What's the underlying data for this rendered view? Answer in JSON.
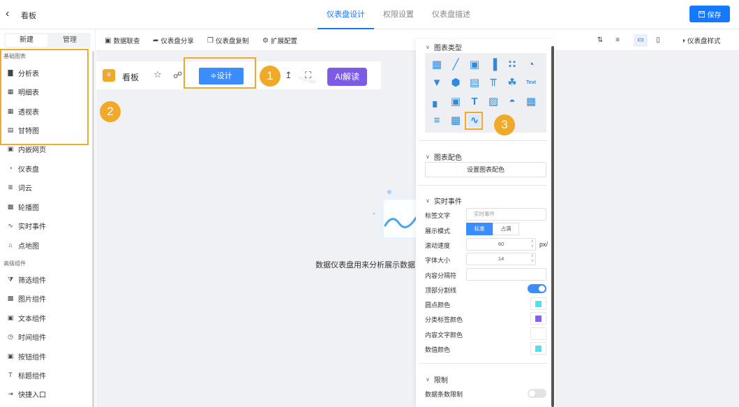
{
  "header": {
    "back_icon": "chevron-left-icon",
    "title": "看板",
    "tabs": [
      {
        "label": "仪表盘设计",
        "active": true
      },
      {
        "label": "权限设置",
        "active": false
      },
      {
        "label": "仪表盘描述",
        "active": false
      }
    ],
    "save_label": "保存",
    "accent": "#1677ff"
  },
  "sidebar": {
    "tabs": [
      "新建",
      "管理"
    ],
    "active_tab": "新建",
    "groups": [
      {
        "title": "基础图表",
        "items": [
          {
            "label": "分析表",
            "icon": "bar-chart-icon"
          },
          {
            "label": "明细表",
            "icon": "detail-table-icon"
          },
          {
            "label": "透视表",
            "icon": "pivot-table-icon"
          },
          {
            "label": "甘特图",
            "icon": "gantt-icon"
          },
          {
            "label": "内嵌网页",
            "icon": "embed-web-icon"
          },
          {
            "label": "仪表盘",
            "icon": "gauge-icon"
          },
          {
            "label": "词云",
            "icon": "word-cloud-icon"
          },
          {
            "label": "轮播图",
            "icon": "carousel-icon"
          },
          {
            "label": "实时事件",
            "icon": "realtime-event-icon"
          },
          {
            "label": "点地图",
            "icon": "point-map-icon"
          }
        ]
      },
      {
        "title": "高级组件",
        "items": [
          {
            "label": "筛选组件",
            "icon": "filter-icon"
          },
          {
            "label": "图片组件",
            "icon": "image-icon"
          },
          {
            "label": "文本组件",
            "icon": "text-icon"
          },
          {
            "label": "时间组件",
            "icon": "clock-icon"
          },
          {
            "label": "按钮组件",
            "icon": "button-icon"
          },
          {
            "label": "标题组件",
            "icon": "title-icon"
          },
          {
            "label": "快捷入口",
            "icon": "shortcut-icon"
          }
        ]
      }
    ]
  },
  "toolbar": {
    "items": [
      {
        "label": "数据联查",
        "icon": "data-link-icon"
      },
      {
        "label": "仪表盘分享",
        "icon": "share-icon"
      },
      {
        "label": "仪表盘复制",
        "icon": "copy-icon"
      },
      {
        "label": "扩展配置",
        "icon": "gear-icon"
      }
    ],
    "style_label": "仪表盘样式"
  },
  "dashboard": {
    "title": "看板",
    "design_label": "≑设计",
    "ai_label": "AI解读",
    "empty_text": "数据仪表盘用来分析展示数据",
    "watermark": "Kocate"
  },
  "annotations": {
    "badge_1": "1",
    "badge_2": "2",
    "badge_3": "3",
    "color": "#f0a929"
  },
  "panel": {
    "chart_type_title": "图表类型",
    "chart_icons": [
      "table-icon",
      "line-chart-icon",
      "kpi-icon",
      "bar-chart-icon",
      "scatter-icon",
      "pie-icon",
      "funnel-icon",
      "radar-icon",
      "stacked-bar-icon",
      "sankey-icon",
      "map-icon",
      "text-chart-icon",
      "dual-axis-icon",
      "code-icon",
      "text-list-icon",
      "trend-icon",
      "gauge-icon",
      "grid-icon",
      "list-icon",
      "image-icon",
      "realtime-line-icon"
    ],
    "chart_color_title": "图表配色",
    "chart_color_button": "设置图表配色",
    "realtime_title": "实时事件",
    "label_text": {
      "label": "标签文字",
      "placeholder": "实时事件"
    },
    "display_mode": {
      "label": "展示模式",
      "options": [
        "标准",
        "占满"
      ],
      "selected": "标准"
    },
    "scroll_speed": {
      "label": "滚动速度",
      "value": "60",
      "unit": "px/"
    },
    "font_size": {
      "label": "字体大小",
      "value": "14"
    },
    "separator": {
      "label": "内容分隔符",
      "value": ""
    },
    "top_divider": {
      "label": "顶部分割线",
      "on": true
    },
    "dot_color": {
      "label": "圆点颜色",
      "color": "#4ae3f0"
    },
    "category_color": {
      "label": "分类标签颜色",
      "color": "#8a5cf6"
    },
    "content_color": {
      "label": "内容文字颜色",
      "color": "#ffffff"
    },
    "value_color": {
      "label": "数值颜色",
      "color": "#4ae3f0"
    },
    "limit_title": "限制",
    "data_limit": {
      "label": "数据条数限制",
      "on": false
    }
  }
}
